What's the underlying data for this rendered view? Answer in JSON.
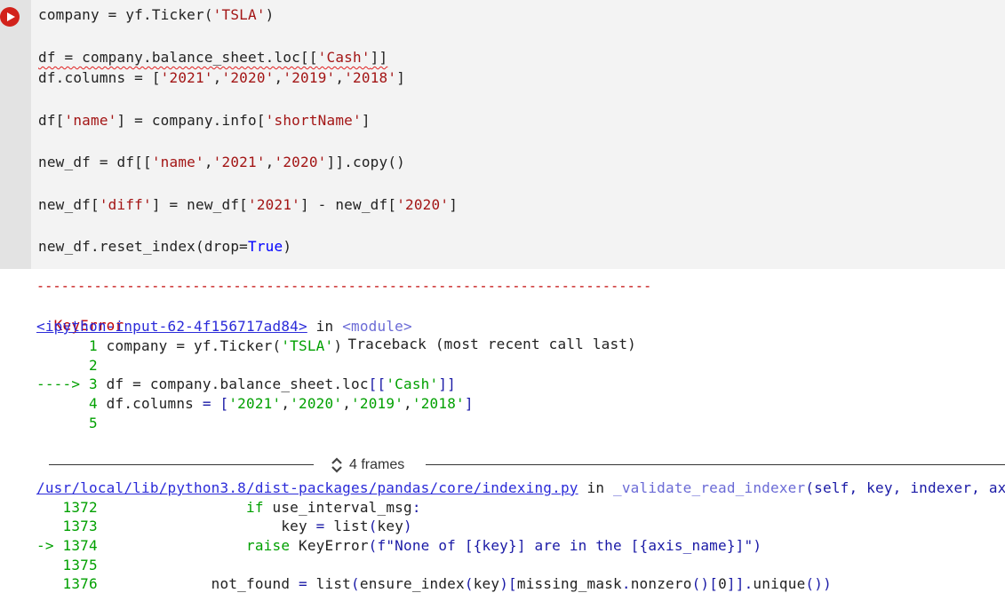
{
  "cell": {
    "code_lines": [
      {
        "segments": [
          {
            "t": "company = yf.Ticker("
          },
          {
            "t": "'TSLA'",
            "c": "str"
          },
          {
            "t": ")"
          }
        ]
      },
      {
        "segments": [
          {
            "t": "df = company.balance_sheet.loc[[",
            "c": "squiggle"
          },
          {
            "t": "'Cash'",
            "c": "str squiggle"
          },
          {
            "t": "]]",
            "c": "squiggle"
          }
        ]
      },
      {
        "segments": [
          {
            "t": "df.columns = ["
          },
          {
            "t": "'2021'",
            "c": "str"
          },
          {
            "t": ","
          },
          {
            "t": "'2020'",
            "c": "str"
          },
          {
            "t": ","
          },
          {
            "t": "'2019'",
            "c": "str"
          },
          {
            "t": ","
          },
          {
            "t": "'2018'",
            "c": "str"
          },
          {
            "t": "]"
          }
        ]
      },
      {
        "segments": [
          {
            "t": "df["
          },
          {
            "t": "'name'",
            "c": "str"
          },
          {
            "t": "] = company.info["
          },
          {
            "t": "'shortName'",
            "c": "str"
          },
          {
            "t": "]"
          }
        ]
      },
      {
        "segments": [
          {
            "t": "new_df = df[["
          },
          {
            "t": "'name'",
            "c": "str"
          },
          {
            "t": ","
          },
          {
            "t": "'2021'",
            "c": "str"
          },
          {
            "t": ","
          },
          {
            "t": "'2020'",
            "c": "str"
          },
          {
            "t": "]].copy()"
          }
        ]
      },
      {
        "segments": [
          {
            "t": "new_df["
          },
          {
            "t": "'diff'",
            "c": "str"
          },
          {
            "t": "] = new_df["
          },
          {
            "t": "'2021'",
            "c": "str"
          },
          {
            "t": "] - new_df["
          },
          {
            "t": "'2020'",
            "c": "str"
          },
          {
            "t": "]"
          }
        ]
      },
      {
        "segments": [
          {
            "t": "new_df.reset_index(drop="
          },
          {
            "t": "True",
            "c": "kw"
          },
          {
            "t": ")"
          }
        ]
      }
    ]
  },
  "output": {
    "separator": "---------------------------------------------------------------------------",
    "error_name": "KeyError",
    "traceback_label": "Traceback (most recent call last)",
    "input_link": "<ipython-input-62-4f156717ad84>",
    "in_word": "in",
    "module_text": "<module>",
    "ctx1": [
      {
        "segments": [
          {
            "t": "      1 ",
            "c": "lineno"
          },
          {
            "t": "company = yf.Ticker("
          },
          {
            "t": "'TSLA'",
            "c": "green"
          },
          {
            "t": ")"
          }
        ]
      },
      {
        "segments": [
          {
            "t": "      2",
            "c": "lineno"
          }
        ]
      },
      {
        "segments": [
          {
            "t": "----> 3 ",
            "c": "green"
          },
          {
            "t": "df = company.balance_sheet.loc"
          },
          {
            "t": "[[",
            "c": "blue"
          },
          {
            "t": "'Cash'",
            "c": "green"
          },
          {
            "t": "]]",
            "c": "blue"
          }
        ]
      },
      {
        "segments": [
          {
            "t": "      4 ",
            "c": "lineno"
          },
          {
            "t": "df.columns "
          },
          {
            "t": "= [",
            "c": "blue"
          },
          {
            "t": "'2021'",
            "c": "green"
          },
          {
            "t": ","
          },
          {
            "t": "'2020'",
            "c": "green"
          },
          {
            "t": ","
          },
          {
            "t": "'2019'",
            "c": "green"
          },
          {
            "t": ","
          },
          {
            "t": "'2018'",
            "c": "green"
          },
          {
            "t": "]",
            "c": "blue"
          }
        ]
      },
      {
        "segments": [
          {
            "t": "      5",
            "c": "lineno"
          }
        ]
      }
    ],
    "frames_label": "4 frames",
    "file_link": "/usr/local/lib/python3.8/dist-packages/pandas/core/indexing.py",
    "func_text": "_validate_read_indexer",
    "func_args": "(self, key, indexer, axis)",
    "ctx2": [
      {
        "segments": [
          {
            "t": "   1372 ",
            "c": "lineno"
          },
          {
            "t": "                "
          },
          {
            "t": "if",
            "c": "green"
          },
          {
            "t": " use_interval_msg"
          },
          {
            "t": ":",
            "c": "blue"
          }
        ]
      },
      {
        "segments": [
          {
            "t": "   1373 ",
            "c": "lineno"
          },
          {
            "t": "                    key "
          },
          {
            "t": "=",
            "c": "blue"
          },
          {
            "t": " list"
          },
          {
            "t": "(",
            "c": "blue"
          },
          {
            "t": "key"
          },
          {
            "t": ")",
            "c": "blue"
          }
        ]
      },
      {
        "segments": [
          {
            "t": "-> 1374 ",
            "c": "green"
          },
          {
            "t": "                "
          },
          {
            "t": "raise",
            "c": "green"
          },
          {
            "t": " KeyError"
          },
          {
            "t": "(f\"None of [{key}] are in the [{axis_name}]\")",
            "c": "blue"
          }
        ]
      },
      {
        "segments": [
          {
            "t": "   1375",
            "c": "lineno"
          }
        ]
      },
      {
        "segments": [
          {
            "t": "   1376 ",
            "c": "lineno"
          },
          {
            "t": "            not_found "
          },
          {
            "t": "=",
            "c": "blue"
          },
          {
            "t": " list"
          },
          {
            "t": "(",
            "c": "blue"
          },
          {
            "t": "ensure_index"
          },
          {
            "t": "(",
            "c": "blue"
          },
          {
            "t": "key"
          },
          {
            "t": ")[",
            "c": "blue"
          },
          {
            "t": "missing_mask"
          },
          {
            "t": ".",
            "c": "blue"
          },
          {
            "t": "nonzero"
          },
          {
            "t": "()[",
            "c": "blue"
          },
          {
            "t": "0"
          },
          {
            "t": "]].",
            "c": "blue"
          },
          {
            "t": "unique"
          },
          {
            "t": "())",
            "c": "blue"
          }
        ]
      }
    ]
  },
  "icons": {
    "run": "play-icon",
    "frames": "expand-collapse-icon"
  },
  "colors": {
    "run_button": "#d2221b",
    "string": "#a31515",
    "keyword": "#0000ff",
    "error": "#c00000",
    "green": "#00a000",
    "link": "#2b2bd9"
  }
}
